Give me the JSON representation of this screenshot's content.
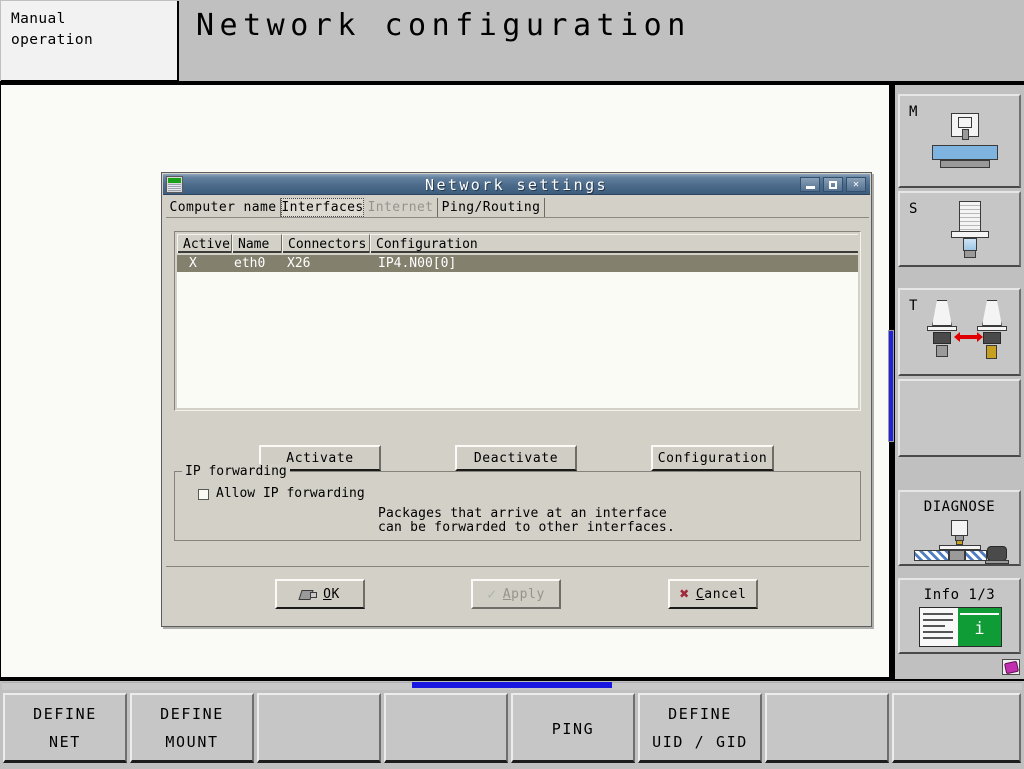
{
  "header": {
    "mode_line1": "Manual",
    "mode_line2": "operation",
    "title": "Network configuration"
  },
  "dialog": {
    "title": "Network settings",
    "icon_name": "network-settings-icon",
    "window_buttons": [
      {
        "name": "minimize-button",
        "label": "_"
      },
      {
        "name": "maximize-button",
        "label": "□"
      },
      {
        "name": "close-button",
        "label": "X"
      }
    ],
    "tabs": [
      {
        "label": "Computer name",
        "selected": false,
        "disabled": false
      },
      {
        "label": "Interfaces",
        "selected": true,
        "disabled": false
      },
      {
        "label": "Internet",
        "selected": false,
        "disabled": true
      },
      {
        "label": "Ping/Routing",
        "selected": false,
        "disabled": false
      }
    ],
    "table": {
      "columns": [
        "Active",
        "Name",
        "Connectors",
        "Configuration"
      ],
      "rows": [
        {
          "active": "X",
          "name": "eth0",
          "connectors": "X26",
          "configuration": "IP4.N00[0]",
          "selected": true
        }
      ]
    },
    "actions": [
      {
        "label": "Activate",
        "name": "activate-button"
      },
      {
        "label": "Deactivate",
        "name": "deactivate-button"
      },
      {
        "label": "Configuration",
        "name": "configuration-button"
      }
    ],
    "ip_forwarding": {
      "group_title": "IP forwarding",
      "checkbox_label": "Allow IP forwarding",
      "checked": false,
      "hint_line1": "Packages that arrive at an interface",
      "hint_line2": "can be forwarded to other interfaces."
    },
    "footer": {
      "ok": {
        "label": "OK",
        "accel": "O",
        "icon": "tag-icon",
        "disabled": false
      },
      "apply": {
        "label": "Apply",
        "accel": "A",
        "icon": "check-icon",
        "disabled": true
      },
      "cancel": {
        "label": "Cancel",
        "accel": "C",
        "icon": "x-icon",
        "disabled": false
      }
    }
  },
  "sidebar": {
    "items": [
      {
        "label": "M",
        "name": "sidebar-item-m",
        "icon": "milling-machine-icon"
      },
      {
        "label": "S",
        "name": "sidebar-item-s",
        "icon": "spindle-icon"
      },
      {
        "label": "T",
        "name": "sidebar-item-t",
        "icon": "tool-change-icon"
      },
      {
        "label": "",
        "name": "sidebar-item-blank",
        "icon": ""
      },
      {
        "label": "DIAGNOSE",
        "name": "sidebar-item-diagnose",
        "icon": "diagnose-icon"
      },
      {
        "label": "Info 1/3",
        "name": "sidebar-item-info",
        "icon": "info-icon"
      }
    ],
    "corner_icon": "disk-icon"
  },
  "softkeys": [
    {
      "line1": "DEFINE",
      "line2": "NET",
      "name": "softkey-define-net"
    },
    {
      "line1": "DEFINE",
      "line2": "MOUNT",
      "name": "softkey-define-mount"
    },
    {
      "line1": "",
      "line2": "",
      "name": "softkey-empty-3"
    },
    {
      "line1": "",
      "line2": "",
      "name": "softkey-empty-4"
    },
    {
      "line1": "",
      "line2": "PING",
      "name": "softkey-ping"
    },
    {
      "line1": "DEFINE",
      "line2": "UID / GID",
      "name": "softkey-define-uid-gid"
    },
    {
      "line1": "",
      "line2": "",
      "name": "softkey-empty-7"
    },
    {
      "line1": "",
      "line2": "",
      "name": "softkey-empty-8"
    }
  ],
  "colors": {
    "accent_blue": "#1818e0",
    "panel_gray": "#d3d0c8",
    "chrome_gray": "#c0c0c0",
    "selection": "#83806e",
    "title_blue": "#4c6b8b"
  }
}
